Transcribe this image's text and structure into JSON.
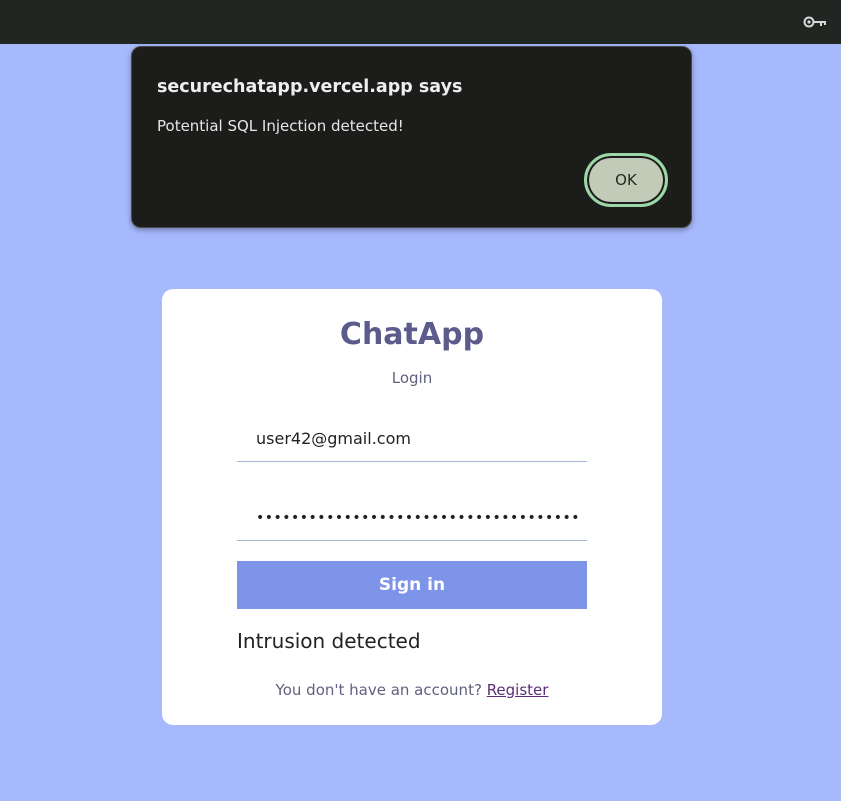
{
  "browser": {
    "key_icon": "key-icon"
  },
  "alert": {
    "title": "securechatapp.vercel.app says",
    "message": "Potential SQL Injection detected!",
    "ok_label": "OK"
  },
  "login": {
    "app_title": "ChatApp",
    "subtitle": "Login",
    "email_value": "user42@gmail.com",
    "password_value": "•••••••••••••••••••••••••••••••••••••",
    "signin_label": "Sign in",
    "error_text": "Intrusion detected",
    "register_prompt": "You don't have an account? ",
    "register_link": "Register"
  },
  "colors": {
    "page_bg": "#a7b9fd",
    "topbar_bg": "#222622",
    "alert_bg": "#1c1c1b",
    "ok_button_bg": "#c2cbb8",
    "ok_button_border": "#9cd7a7",
    "signin_bg": "#7d94e9",
    "title_color": "#5b5b8c"
  }
}
